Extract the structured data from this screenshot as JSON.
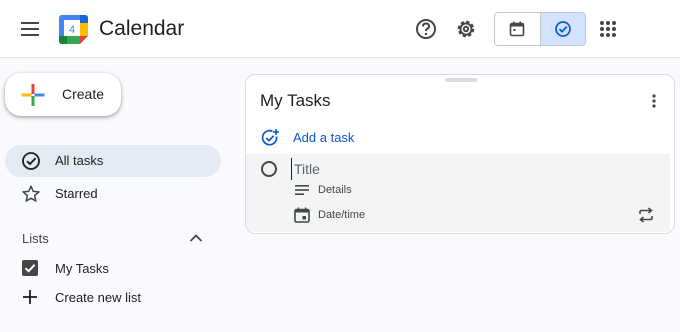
{
  "header": {
    "menu_icon": "hamburger-menu-icon",
    "logo_day": "4",
    "app_title": "Calendar",
    "help_icon": "help-circle-icon",
    "settings_icon": "gear-icon",
    "calendar_view_icon": "calendar-icon",
    "tasks_view_icon": "task-check-icon",
    "apps_icon": "apps-grid-icon"
  },
  "sidebar": {
    "create_label": "Create",
    "nav": [
      {
        "label": "All tasks",
        "icon": "check-circle-icon",
        "active": true
      },
      {
        "label": "Starred",
        "icon": "star-icon",
        "active": false
      }
    ],
    "lists_header": "Lists",
    "lists": [
      {
        "label": "My Tasks",
        "icon": "checked-checkbox-icon"
      },
      {
        "label": "Create new list",
        "icon": "plus-icon"
      }
    ]
  },
  "task_card": {
    "title": "My Tasks",
    "add_task_label": "Add a task",
    "new_task": {
      "title_placeholder": "Title",
      "details_label": "Details",
      "date_label": "Date/time"
    }
  },
  "colors": {
    "accent": "#0b57d0",
    "active_toggle": "#d3e3fd",
    "active_nav": "#e4eaf4",
    "background": "#f8fafd"
  }
}
